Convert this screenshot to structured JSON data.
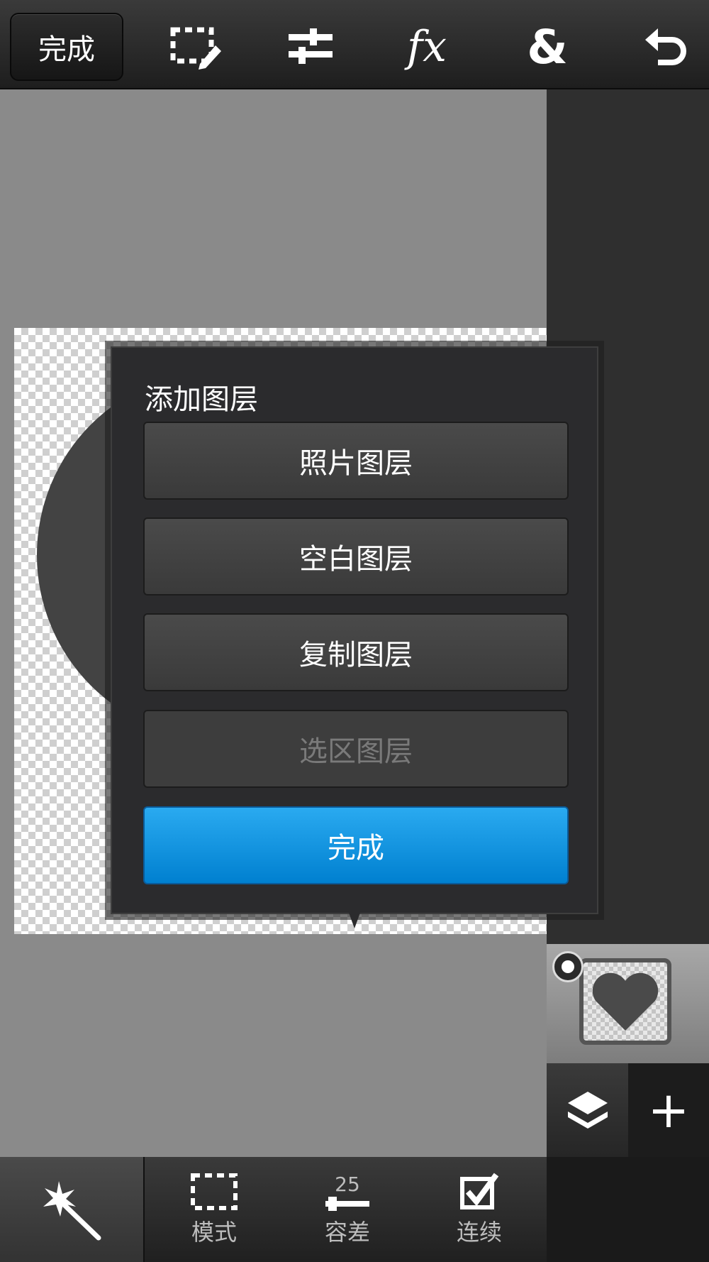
{
  "top_toolbar": {
    "done_label": "完成",
    "icons": [
      "selection-edit-icon",
      "adjustments-icon",
      "fx-icon",
      "ampersand-icon",
      "undo-icon"
    ],
    "fx_label": "fx",
    "amp_label": "&"
  },
  "dialog": {
    "title": "添加图层",
    "buttons": [
      {
        "label": "照片图层",
        "enabled": true
      },
      {
        "label": "空白图层",
        "enabled": true
      },
      {
        "label": "复制图层",
        "enabled": true
      },
      {
        "label": "选区图层",
        "enabled": false
      }
    ],
    "done_label": "完成"
  },
  "layers_panel": {
    "add_label": "+",
    "thumbnail_icon": "heart-icon"
  },
  "bottom_toolbar": {
    "mode_label": "模式",
    "tolerance_value": "25",
    "tolerance_label": "容差",
    "contiguous_label": "连续"
  },
  "colors": {
    "accent": "#1a98e6",
    "toolbar": "#2a2a2a",
    "dialog": "#2b2b2d"
  }
}
